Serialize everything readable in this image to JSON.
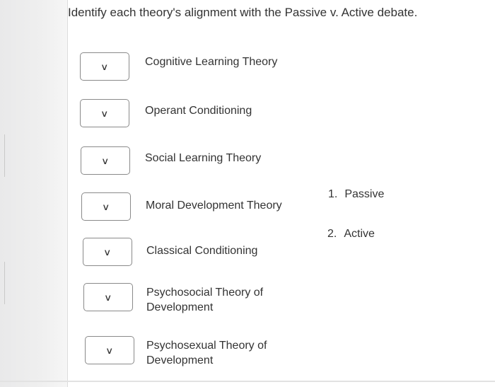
{
  "question": "Identify each theory's alignment with the Passive v. Active debate.",
  "items": [
    {
      "label": "Cognitive Learning Theory",
      "selected": "",
      "icon": "chevron-down-icon"
    },
    {
      "label": "Operant Conditioning",
      "selected": "",
      "icon": "chevron-down-icon"
    },
    {
      "label": "Social Learning Theory",
      "selected": "",
      "icon": "chevron-down-icon"
    },
    {
      "label": "Moral Development Theory",
      "selected": "",
      "icon": "chevron-down-icon"
    },
    {
      "label": "Classical Conditioning",
      "selected": "",
      "icon": "chevron-down-icon"
    },
    {
      "label_line1": "Psychosocial Theory of",
      "label_line2": "Development",
      "selected": "",
      "icon": "chevron-down-icon"
    },
    {
      "label_line1": "Psychosexual Theory of",
      "label_line2": "Development",
      "selected": "",
      "icon": "chevron-down-icon"
    }
  ],
  "options": [
    {
      "number": "1.",
      "label": "Passive"
    },
    {
      "number": "2.",
      "label": "Active"
    }
  ],
  "chevron_glyph": "∨"
}
